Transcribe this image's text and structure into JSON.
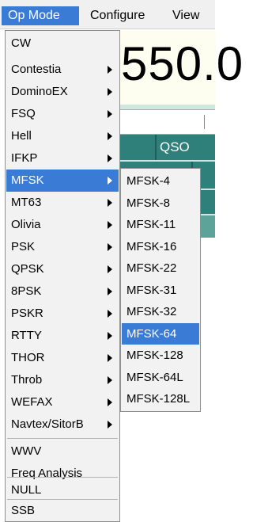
{
  "menubar": {
    "items": [
      {
        "label": "Op Mode"
      },
      {
        "label": "Configure"
      },
      {
        "label": "View"
      }
    ]
  },
  "background": {
    "frequency_display": "550.0",
    "qso_button": "QSO"
  },
  "op_mode_menu": {
    "items": [
      {
        "label": "CW",
        "submenu": false
      },
      {
        "label": "Contestia",
        "submenu": true
      },
      {
        "label": "DominoEX",
        "submenu": true
      },
      {
        "label": "FSQ",
        "submenu": true
      },
      {
        "label": "Hell",
        "submenu": true
      },
      {
        "label": "IFKP",
        "submenu": true
      },
      {
        "label": "MFSK",
        "submenu": true,
        "highlighted": true
      },
      {
        "label": "MT63",
        "submenu": true
      },
      {
        "label": "Olivia",
        "submenu": true
      },
      {
        "label": "PSK",
        "submenu": true
      },
      {
        "label": "QPSK",
        "submenu": true
      },
      {
        "label": "8PSK",
        "submenu": true
      },
      {
        "label": "PSKR",
        "submenu": true
      },
      {
        "label": "RTTY",
        "submenu": true
      },
      {
        "label": "THOR",
        "submenu": true
      },
      {
        "label": "Throb",
        "submenu": true
      },
      {
        "label": "WEFAX",
        "submenu": true
      },
      {
        "label": "Navtex/SitorB",
        "submenu": true
      },
      {
        "label": "WWV",
        "submenu": false
      },
      {
        "label": "Freq Analysis",
        "submenu": false
      },
      {
        "label": "NULL",
        "submenu": false
      },
      {
        "label": "SSB",
        "submenu": false
      }
    ]
  },
  "mfsk_submenu": {
    "items": [
      {
        "label": "MFSK-4"
      },
      {
        "label": "MFSK-8"
      },
      {
        "label": "MFSK-11"
      },
      {
        "label": "MFSK-16"
      },
      {
        "label": "MFSK-22"
      },
      {
        "label": "MFSK-31"
      },
      {
        "label": "MFSK-32"
      },
      {
        "label": "MFSK-64",
        "highlighted": true
      },
      {
        "label": "MFSK-128"
      },
      {
        "label": "MFSK-64L"
      },
      {
        "label": "MFSK-128L"
      }
    ]
  },
  "colors": {
    "highlight": "#3a7bd5",
    "menu_bg": "#f2f2f2",
    "panel_teal": "#2f7f7a"
  },
  "icons": {
    "submenu_arrow": "chevron-right-icon"
  }
}
